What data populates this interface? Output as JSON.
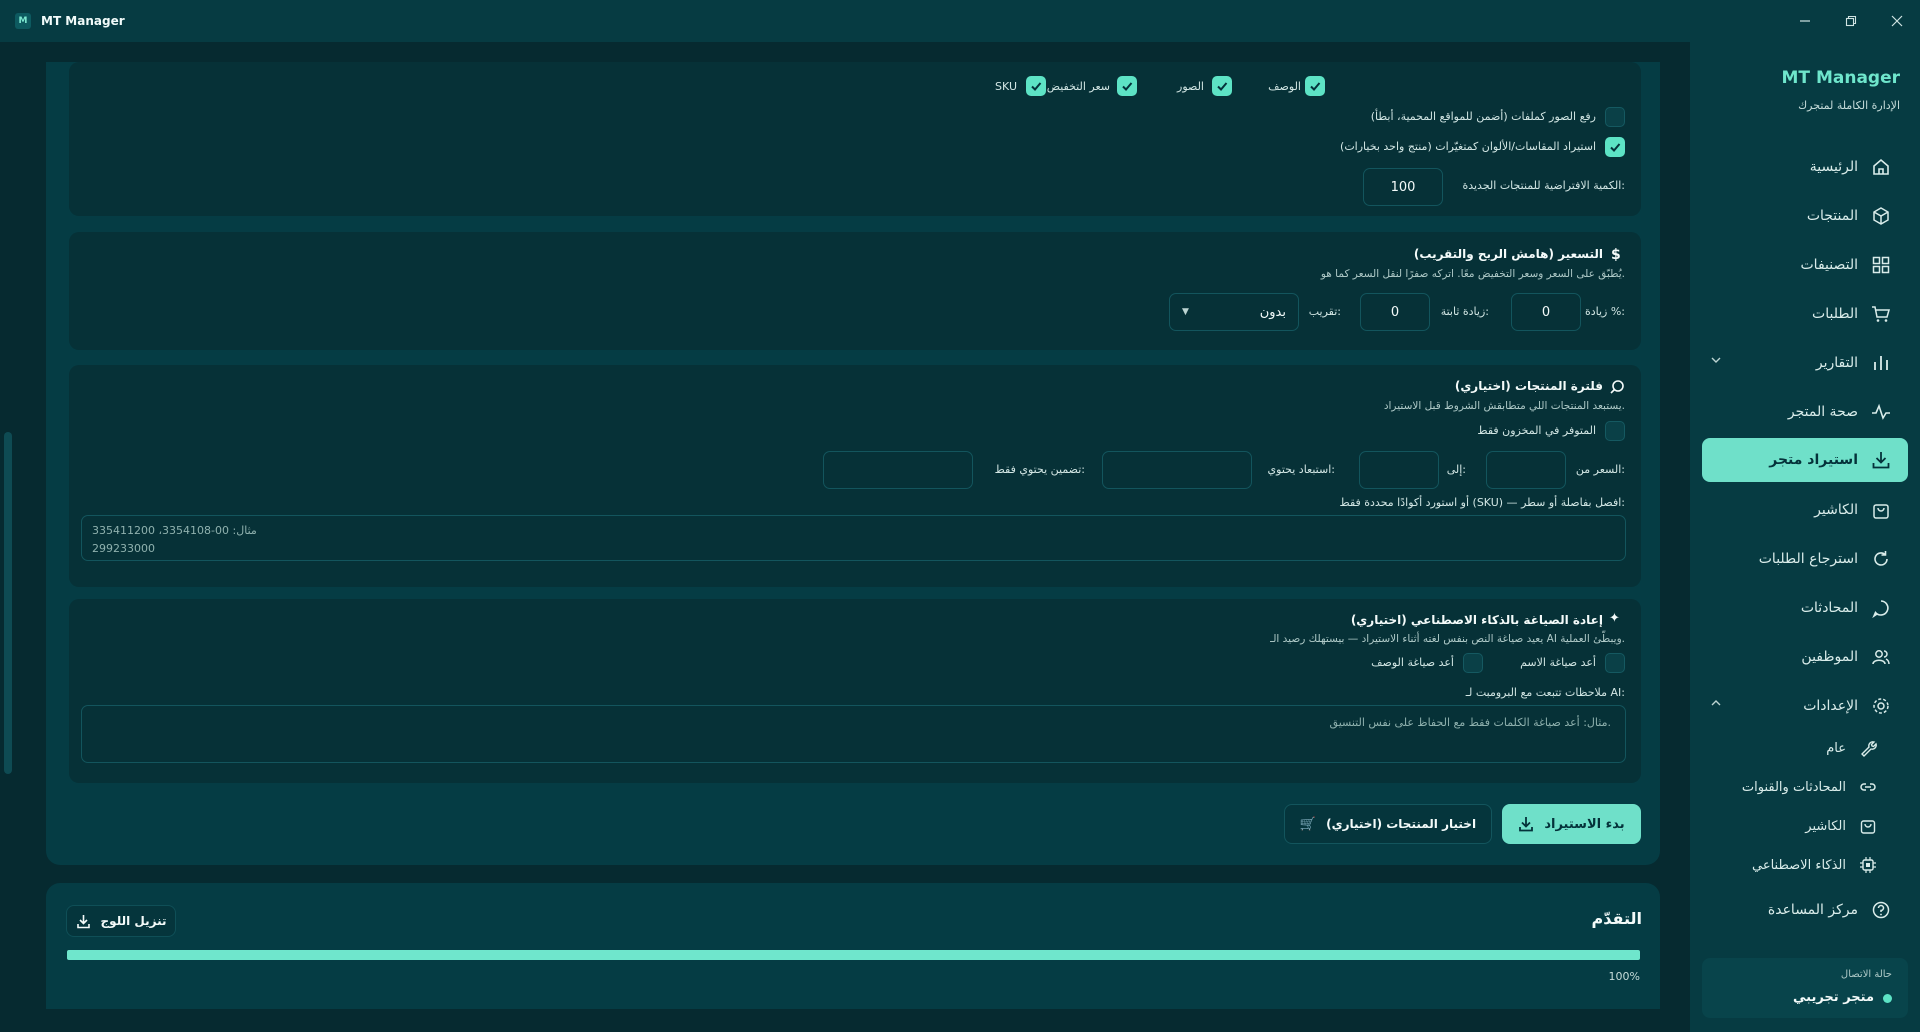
{
  "app": {
    "title": "MT Manager"
  },
  "options": {
    "sku": "SKU",
    "discount_price": "سعر التخفيض",
    "images": "الصور",
    "description": "الوصف",
    "upload_images_files": "رفع الصور كملفات (أضمن للمواقع المحمية، أبطأ)",
    "import_variants": "استيراد المقاسات/الألوان كمتغيّرات (منتج واحد بخيارات)",
    "default_qty_label": "الكمية الافتراضية للمنتجات الجديدة:",
    "default_qty_value": "100"
  },
  "pricing": {
    "title": "التسعير (هامش الربح والتقريب)",
    "desc": "يُطبّق على السعر وسعر التخفيض معًا. اتركه صفرًا لنقل السعر كما هو.",
    "percent_label": "زيادة %:",
    "percent_value": "0",
    "fixed_label": "زيادة ثابتة:",
    "fixed_value": "0",
    "rounding_label": "تقريب:",
    "rounding_value": "بدون"
  },
  "filter": {
    "title": "فلترة المنتجات (اختياري)",
    "desc": "يستبعد المنتجات اللي متطابقش الشروط قبل الاستيراد.",
    "in_stock_only": "المتوفر في المخزون فقط",
    "price_from": "السعر من:",
    "to": "إلى:",
    "exclude_contains": "استبعاد يحتوي:",
    "include_only": "تضمين يحتوي فقط:",
    "sku_label": "أو استورد أكوادًا محددة فقط (SKU) — افصل بفاصلة أو سطر:",
    "sku_placeholder_line1": "مثال:  00-3354108، 335411200",
    "sku_placeholder_line2": "299233000"
  },
  "ai": {
    "title": "إعادة الصياغة بالذكاء الاصطناعي (اختياري)",
    "desc": "يعيد صياغة النص بنفس لغته أثناء الاستيراد — بيستهلك رصيد الـ AI ويبطّئ العملية.",
    "rewrite_name": "أعد صياغة الاسم",
    "rewrite_desc": "أعد صياغة الوصف",
    "notes_label": "ملاحظات تتبعت مع البرومبت لـ AI:",
    "notes_placeholder": "مثال: أعد صياغة الكلمات فقط مع الحفاظ على نفس التنسيق."
  },
  "actions": {
    "start_import": "بدء الاستيراد",
    "choose_products": "اختيار المنتجات (اختياري)"
  },
  "progress": {
    "title": "التقدّم",
    "download_log": "تنزيل اللوج",
    "percent_text": "100%",
    "value": 100
  },
  "sidebar": {
    "brand": "MT Manager",
    "tagline": "الإدارة الكاملة لمتجرك",
    "items": [
      {
        "label": "الرئيسية",
        "icon": "home-icon"
      },
      {
        "label": "المنتجات",
        "icon": "box-icon"
      },
      {
        "label": "التصنيفات",
        "icon": "grid-icon"
      },
      {
        "label": "الطلبات",
        "icon": "cart-icon"
      },
      {
        "label": "التقارير",
        "icon": "bar-chart-icon"
      },
      {
        "label": "صحة المتجر",
        "icon": "pulse-icon"
      },
      {
        "label": "استيراد متجر",
        "icon": "download-icon"
      },
      {
        "label": "الكاشير",
        "icon": "bag-icon"
      },
      {
        "label": "استرجاع الطلبات",
        "icon": "refresh-icon"
      },
      {
        "label": "المحادثات",
        "icon": "chat-icon"
      },
      {
        "label": "الموظفين",
        "icon": "users-icon"
      },
      {
        "label": "الإعدادات",
        "icon": "gear-icon"
      }
    ],
    "settings_sub": [
      {
        "label": "عام",
        "icon": "wrench-icon"
      },
      {
        "label": "المحادثات والقنوات",
        "icon": "link-icon"
      },
      {
        "label": "الكاشير",
        "icon": "bag-icon"
      },
      {
        "label": "الذكاء الاصطناعي",
        "icon": "chip-icon"
      }
    ],
    "help": "مركز المساعدة",
    "connection": {
      "label": "حالة الاتصال",
      "store": "متجر تجريبي",
      "status_color": "#5de3c5"
    }
  },
  "colors": {
    "accent": "#6fe0c9",
    "bg": "#062a30",
    "panel": "#053c44"
  }
}
